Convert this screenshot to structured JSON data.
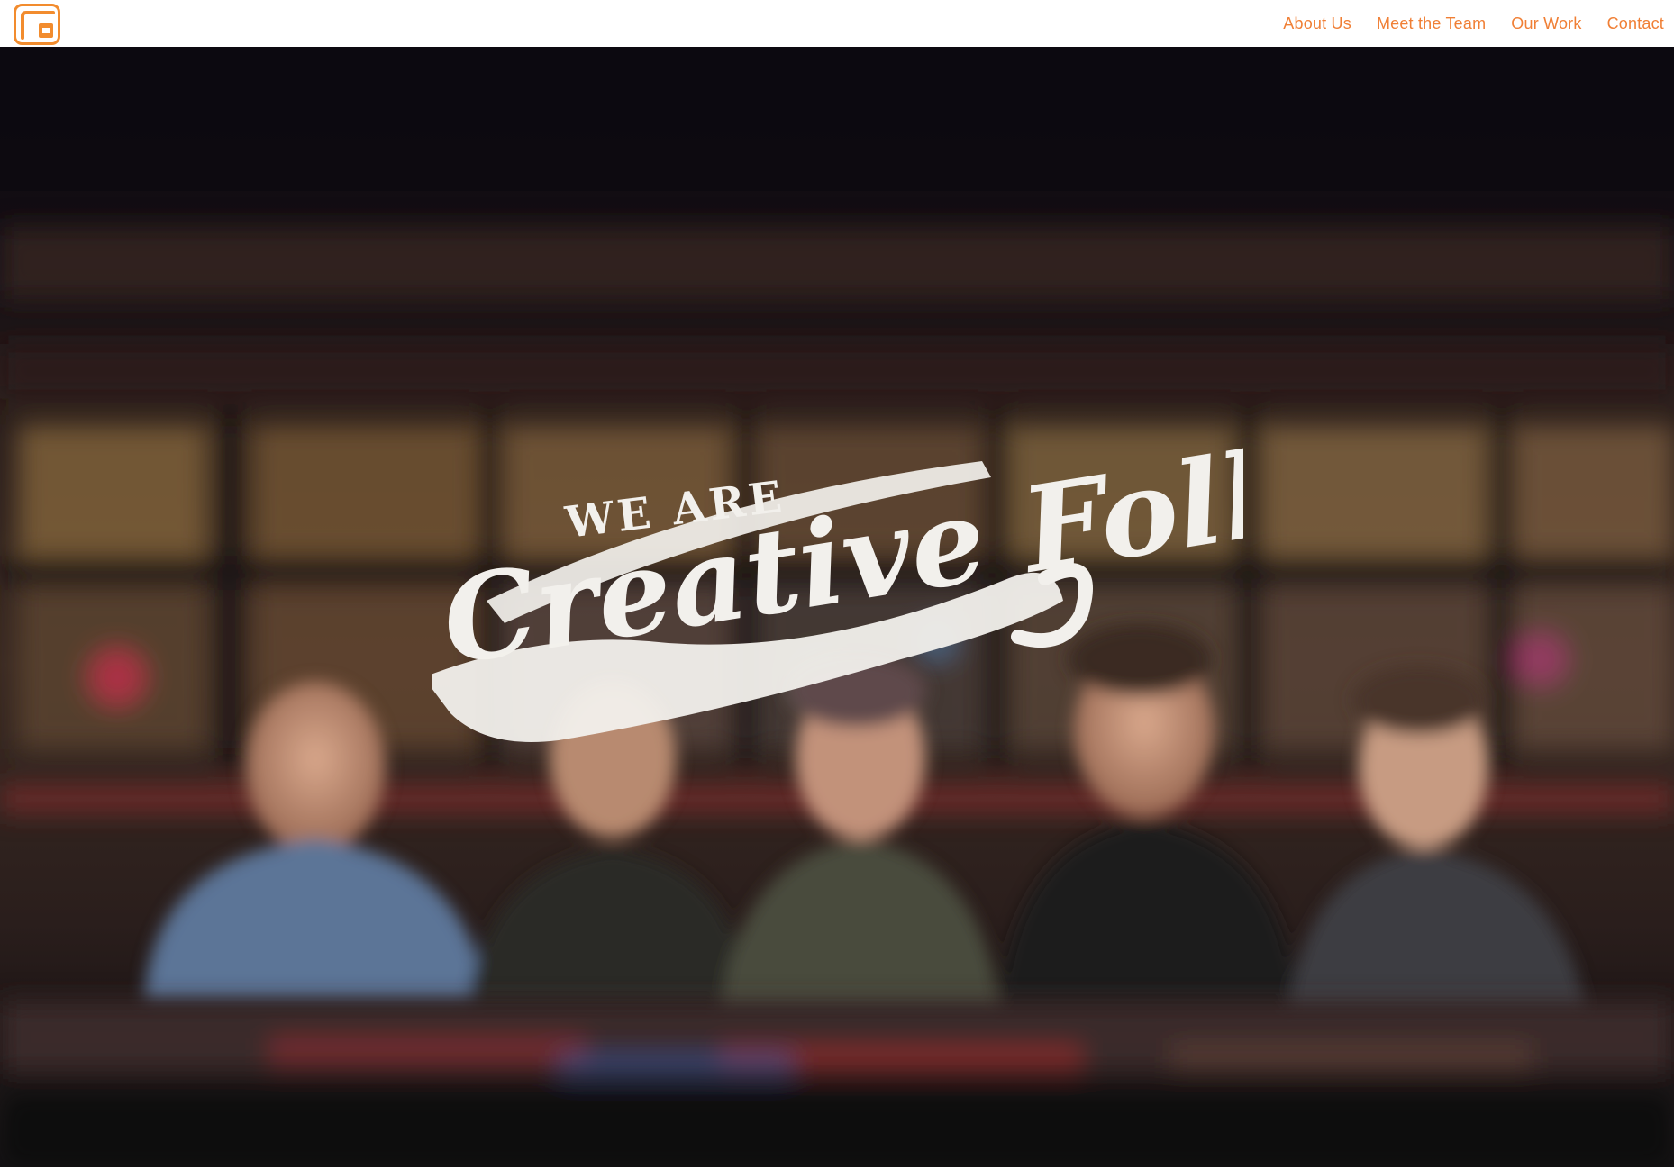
{
  "header": {
    "logo_icon": "orange-window-logo",
    "accent_color": "#f07f35",
    "nav": [
      {
        "label": "About Us"
      },
      {
        "label": "Meet the Team"
      },
      {
        "label": "Our Work"
      },
      {
        "label": "Contact"
      }
    ]
  },
  "hero": {
    "title_line1": "WE ARE",
    "title_line2": "Creative Folk",
    "background": "blurred-team-photo-at-bar"
  }
}
